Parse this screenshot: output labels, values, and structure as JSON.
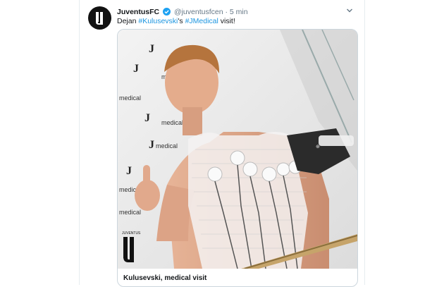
{
  "tweet": {
    "display_name": "JuventusFC",
    "handle": "@juventusfcen",
    "separator": "·",
    "time": "5 min",
    "text_parts": [
      "Dejan ",
      "#Kulusevski",
      "'s ",
      "#JMedical",
      " visit!"
    ],
    "avatar_icon": "juventus-logo-icon",
    "verified_icon": "verified-badge-icon",
    "menu_icon": "chevron-down-icon"
  },
  "card": {
    "title": "Kulusevski, medical visit",
    "wall_text": [
      "medical",
      "medical",
      "medical",
      "medical",
      "medical",
      "medical"
    ],
    "logo_caption": "JUVENTUS"
  },
  "colors": {
    "link": "#1b95e0",
    "verified": "#1da1f2",
    "text": "#14171a",
    "muted": "#657786"
  }
}
